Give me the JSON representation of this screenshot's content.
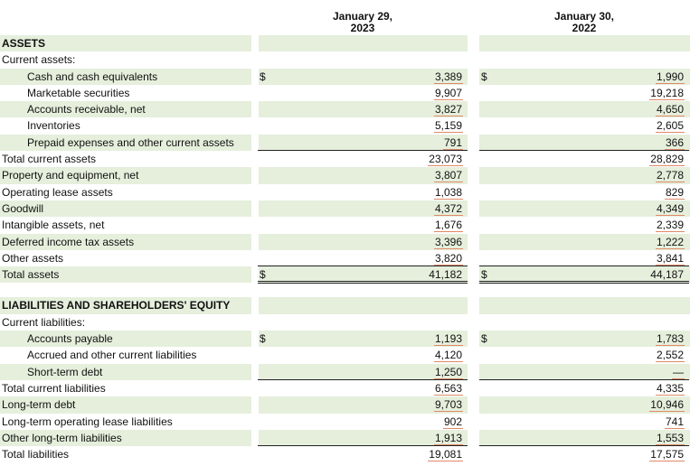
{
  "columns": {
    "col1": [
      "January 29,",
      "2023"
    ],
    "col2": [
      "January 30,",
      "2022"
    ]
  },
  "currency_symbol": "$",
  "rows": [
    {
      "label": "ASSETS",
      "style": "heading",
      "v1": "",
      "v2": "",
      "cur": false
    },
    {
      "label": "Current assets:",
      "style": "plain",
      "v1": "",
      "v2": "",
      "cur": false
    },
    {
      "label": "Cash and cash equivalents",
      "style": "indent",
      "v1": "3,389",
      "v2": "1,990",
      "cur": true
    },
    {
      "label": "Marketable securities",
      "style": "indent",
      "v1": "9,907",
      "v2": "19,218",
      "cur": false
    },
    {
      "label": "Accounts receivable, net",
      "style": "indent",
      "v1": "3,827",
      "v2": "4,650",
      "cur": false
    },
    {
      "label": "Inventories",
      "style": "indent",
      "v1": "5,159",
      "v2": "2,605",
      "cur": false
    },
    {
      "label": "Prepaid expenses and other current assets",
      "style": "indent",
      "v1": "791",
      "v2": "366",
      "cur": false
    },
    {
      "label": "Total current assets",
      "style": "plain",
      "v1": "23,073",
      "v2": "28,829",
      "cur": false
    },
    {
      "label": "Property and equipment, net",
      "style": "plain",
      "v1": "3,807",
      "v2": "2,778",
      "cur": false
    },
    {
      "label": "Operating lease assets",
      "style": "plain",
      "v1": "1,038",
      "v2": "829",
      "cur": false
    },
    {
      "label": "Goodwill",
      "style": "plain",
      "v1": "4,372",
      "v2": "4,349",
      "cur": false
    },
    {
      "label": "Intangible assets, net",
      "style": "plain",
      "v1": "1,676",
      "v2": "2,339",
      "cur": false
    },
    {
      "label": "Deferred income tax assets",
      "style": "plain",
      "v1": "3,396",
      "v2": "1,222",
      "cur": false
    },
    {
      "label": "Other assets",
      "style": "plain",
      "v1": "3,820",
      "v2": "3,841",
      "cur": false
    },
    {
      "label": "Total assets",
      "style": "plain",
      "v1": "41,182",
      "v2": "44,187",
      "cur": true
    },
    {
      "label": "",
      "style": "blank",
      "v1": "",
      "v2": "",
      "cur": false
    },
    {
      "label": "LIABILITIES AND SHAREHOLDERS' EQUITY",
      "style": "heading",
      "v1": "",
      "v2": "",
      "cur": false
    },
    {
      "label": "Current liabilities:",
      "style": "plain",
      "v1": "",
      "v2": "",
      "cur": false
    },
    {
      "label": "Accounts payable",
      "style": "indent",
      "v1": "1,193",
      "v2": "1,783",
      "cur": true
    },
    {
      "label": "Accrued and other current liabilities",
      "style": "indent",
      "v1": "4,120",
      "v2": "2,552",
      "cur": false
    },
    {
      "label": "Short-term debt",
      "style": "indent",
      "v1": "1,250",
      "v2": "—",
      "cur": false
    },
    {
      "label": "Total current liabilities",
      "style": "plain",
      "v1": "6,563",
      "v2": "4,335",
      "cur": false
    },
    {
      "label": "Long-term debt",
      "style": "plain",
      "v1": "9,703",
      "v2": "10,946",
      "cur": false
    },
    {
      "label": "Long-term operating lease liabilities",
      "style": "plain",
      "v1": "902",
      "v2": "741",
      "cur": false
    },
    {
      "label": "Other long-term liabilities",
      "style": "plain",
      "v1": "1,913",
      "v2": "1,553",
      "cur": false
    },
    {
      "label": "Total liabilities",
      "style": "plain",
      "v1": "19,081",
      "v2": "17,575",
      "cur": false
    }
  ]
}
